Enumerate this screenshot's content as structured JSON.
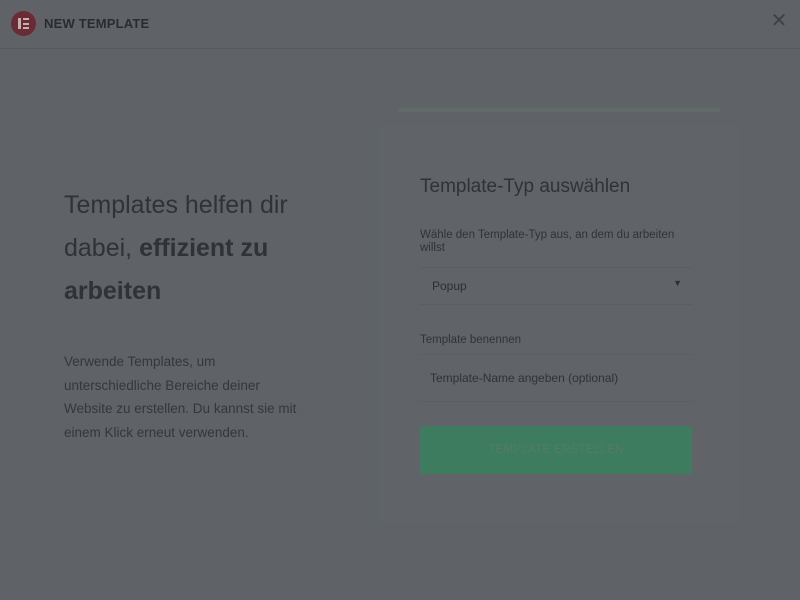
{
  "header": {
    "title": "NEW TEMPLATE",
    "logo_icon": "elementor-logo-icon",
    "close_icon": "close-icon"
  },
  "intro": {
    "headline_part1": "Templates helfen dir dabei, ",
    "headline_bold": "effizient zu arbeiten",
    "description": "Verwende Templates, um unterschiedliche Bereiche deiner Website zu erstellen. Du kannst sie mit einem Klick erneut verwenden."
  },
  "form": {
    "title": "Template-Typ auswählen",
    "type_label": "Wähle den Template-Typ aus, an dem du arbeiten willst",
    "type_value": "Popup",
    "name_label": "Template benennen",
    "name_placeholder": "Template-Name angeben (optional)",
    "name_value": "",
    "submit_label": "TEMPLATE ERSTELLEN"
  },
  "colors": {
    "overlay": "#5f6266",
    "accent_button": "#3d7c5e",
    "logo": "#6a2b35"
  }
}
